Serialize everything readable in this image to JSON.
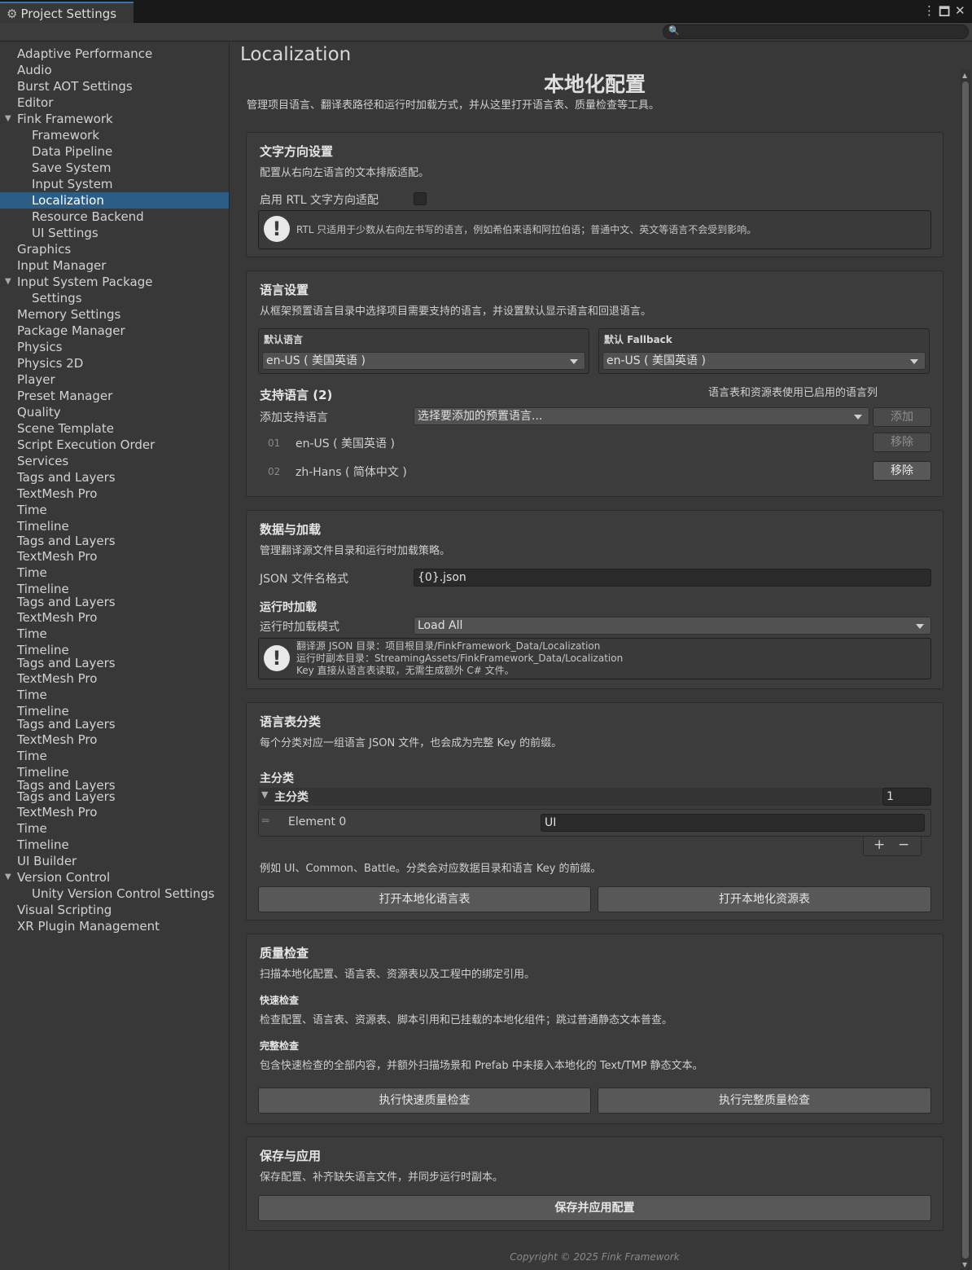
{
  "window": {
    "tab_title": "Project Settings"
  },
  "sidebar": {
    "items": [
      {
        "label": "Adaptive Performance",
        "level": 0
      },
      {
        "label": "Audio",
        "level": 0
      },
      {
        "label": "Burst AOT Settings",
        "level": 0
      },
      {
        "label": "Editor",
        "level": 0
      },
      {
        "label": "Fink Framework",
        "level": 0,
        "expanded": true
      },
      {
        "label": "Framework",
        "level": 1
      },
      {
        "label": "Data Pipeline",
        "level": 1
      },
      {
        "label": "Save System",
        "level": 1
      },
      {
        "label": "Input System",
        "level": 1
      },
      {
        "label": "Localization",
        "level": 1,
        "selected": true
      },
      {
        "label": "Resource Backend",
        "level": 1
      },
      {
        "label": "UI Settings",
        "level": 1
      },
      {
        "label": "Graphics",
        "level": 0
      },
      {
        "label": "Input Manager",
        "level": 0
      },
      {
        "label": "Input System Package",
        "level": 0,
        "expanded": true
      },
      {
        "label": "Settings",
        "level": 1
      },
      {
        "label": "Memory Settings",
        "level": 0
      },
      {
        "label": "Package Manager",
        "level": 0
      },
      {
        "label": "Physics",
        "level": 0
      },
      {
        "label": "Physics 2D",
        "level": 0
      },
      {
        "label": "Player",
        "level": 0
      },
      {
        "label": "Preset Manager",
        "level": 0
      },
      {
        "label": "Quality",
        "level": 0
      },
      {
        "label": "Scene Template",
        "level": 0
      },
      {
        "label": "Script Execution Order",
        "level": 0
      },
      {
        "label": "Services",
        "level": 0
      },
      {
        "label": "Tags and Layers",
        "level": 0
      },
      {
        "label": "TextMesh Pro",
        "level": 0
      },
      {
        "label": "Time",
        "level": 0
      },
      {
        "label": "Timeline",
        "level": 0
      }
    ],
    "ghost_items": [
      {
        "label": "Tags and Layers"
      },
      {
        "label": "TextMesh Pro"
      },
      {
        "label": "Time"
      },
      {
        "label": "Timeline"
      },
      {
        "label": "Tags and Layers"
      },
      {
        "label": "TextMesh Pro"
      },
      {
        "label": "Time"
      },
      {
        "label": "Timeline"
      },
      {
        "label": "Tags and Layers"
      },
      {
        "label": "TextMesh Pro"
      },
      {
        "label": "Time"
      },
      {
        "label": "Timeline"
      },
      {
        "label": "Tags and Layers"
      },
      {
        "label": "TextMesh Pro"
      },
      {
        "label": "Time"
      },
      {
        "label": "Timeline"
      },
      {
        "label": "Tags and Layers"
      },
      {
        "label": "Tags and Layers"
      },
      {
        "label": "TextMesh Pro"
      },
      {
        "label": "Time"
      },
      {
        "label": "Timeline"
      },
      {
        "label": "UI Builder"
      },
      {
        "label": "Version Control"
      },
      {
        "label": "Unity Version Control Settings"
      },
      {
        "label": "Visual Scripting"
      },
      {
        "label": "XR Plugin Management"
      }
    ]
  },
  "page": {
    "title": "Localization",
    "main_title": "本地化配置",
    "main_desc": "管理项目语言、翻译表路径和运行时加载方式，并从这里打开语言表、质量检查等工具。",
    "footer": "Copyright © 2025 Fink Framework"
  },
  "rtl": {
    "header": "文字方向设置",
    "desc": "配置从右向左语言的文本排版适配。",
    "toggle_label": "启用 RTL 文字方向适配",
    "toggle_checked": false,
    "help": "RTL 只适用于少数从右向左书写的语言，例如希伯来语和阿拉伯语；普通中文、英文等语言不会受到影响。"
  },
  "lang": {
    "header": "语言设置",
    "desc": "从框架预置语言目录中选择项目需要支持的语言，并设置默认显示语言和回退语言。",
    "default_label": "默认语言",
    "default_value": "en-US ( 美国英语 )",
    "fallback_label": "默认 Fallback",
    "fallback_value": "en-US ( 美国英语 )",
    "supported_header": "支持语言 (2)",
    "supported_note": "语言表和资源表使用已启用的语言列",
    "add_label": "添加支持语言",
    "add_placeholder": "选择要添加的预置语言...",
    "add_button": "添加",
    "list": [
      {
        "num": "01",
        "name": "en-US ( 美国英语 )",
        "button": "移除",
        "disabled": true
      },
      {
        "num": "02",
        "name": "zh-Hans ( 简体中文 )",
        "button": "移除",
        "disabled": false
      }
    ]
  },
  "data": {
    "header": "数据与加载",
    "desc": "管理翻译源文件目录和运行时加载策略。",
    "json_label": "JSON 文件名格式",
    "json_value": "{0}.json",
    "runtime_header": "运行时加载",
    "mode_label": "运行时加载模式",
    "mode_value": "Load All",
    "help_lines": [
      "翻译源 JSON 目录：项目根目录/FinkFramework_Data/Localization",
      "运行时副本目录：StreamingAssets/FinkFramework_Data/Localization",
      "Key 直接从语言表读取，无需生成额外 C# 文件。"
    ]
  },
  "categories": {
    "header": "语言表分类",
    "desc": "每个分类对应一组语言 JSON 文件，也会成为完整 Key 的前缀。",
    "main_label": "主分类",
    "foldout_label": "主分类",
    "count": "1",
    "element_label": "Element 0",
    "element_value": "UI",
    "plus": "+",
    "minus": "−",
    "hint": "例如 UI、Common、Battle。分类会对应数据目录和语言 Key 的前缀。",
    "open_lang_table": "打开本地化语言表",
    "open_res_table": "打开本地化资源表"
  },
  "quality": {
    "header": "质量检查",
    "desc": "扫描本地化配置、语言表、资源表以及工程中的绑定引用。",
    "quick_title": "快速检查",
    "quick_desc": "检查配置、语言表、资源表、脚本引用和已挂载的本地化组件；跳过普通静态文本普查。",
    "full_title": "完整检查",
    "full_desc": "包含快速检查的全部内容，并额外扫描场景和 Prefab 中未接入本地化的 Text/TMP 静态文本。",
    "quick_button": "执行快速质量检查",
    "full_button": "执行完整质量检查"
  },
  "save": {
    "header": "保存与应用",
    "desc": "保存配置、补齐缺失语言文件，并同步运行时副本。",
    "button": "保存并应用配置"
  },
  "colors": {
    "selection": "#2c5d87",
    "accent_tab": "#3a72b0"
  }
}
